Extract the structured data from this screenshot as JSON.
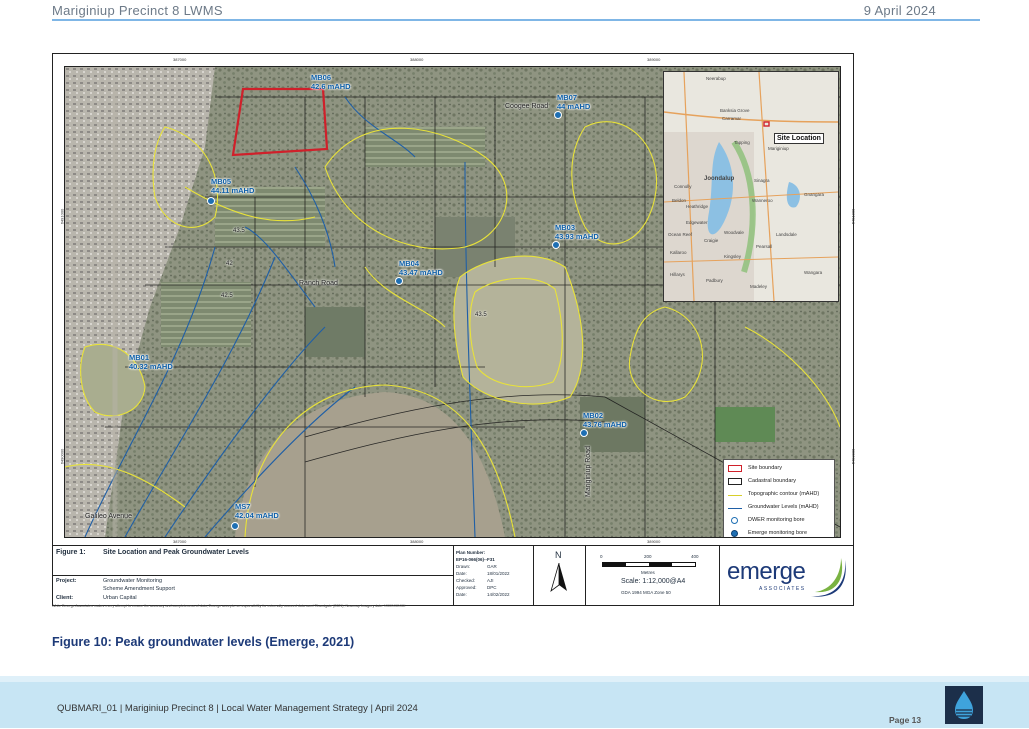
{
  "header": {
    "left": "Mariginiup Precinct 8 LWMS",
    "right": "9 April 2024"
  },
  "map": {
    "coords_top": [
      "387000",
      "388000",
      "389000"
    ],
    "coords_bottom": [
      "387000",
      "388000",
      "389000"
    ],
    "coords_side": [
      "6491000",
      "6490000"
    ],
    "bores": [
      {
        "id": "MB06",
        "level": "42.6 mAHD"
      },
      {
        "id": "MB07",
        "level": "44 mAHD"
      },
      {
        "id": "MB05",
        "level": "44.11 mAHD"
      },
      {
        "id": "MB03",
        "level": "43.93 mAHD"
      },
      {
        "id": "MB04",
        "level": "43.47 mAHD"
      },
      {
        "id": "MB01",
        "level": "40.32 mAHD"
      },
      {
        "id": "MB02",
        "level": "43.76 mAHD"
      },
      {
        "id": "MS7",
        "level": "42.04 mAHD"
      }
    ],
    "roads": [
      "Ranch Road",
      "Coogee Road",
      "Galileo Avenue",
      "Mariginiup Road"
    ],
    "contour_labels": [
      "43.5",
      "42",
      "42.5",
      "43.5"
    ],
    "inset": {
      "site_label": "Site Location",
      "places": [
        "Neerabup",
        "Banksia Grove",
        "Carramar",
        "Tapping",
        "Mariginiup",
        "Joondalup",
        "Connolly",
        "Sinagra",
        "Wanneroo",
        "Heathridge",
        "Edgewater",
        "Woodvale",
        "Craigie",
        "Kingsley",
        "Landsdale",
        "Pearsall",
        "Kallaroo",
        "Hillarys",
        "Padbury",
        "Madeley",
        "Gnangara",
        "Wangara",
        "Ocean Reef",
        "Beldon"
      ]
    },
    "legend": [
      {
        "label": "Site boundary",
        "sym": "site"
      },
      {
        "label": "Cadastral boundary",
        "sym": "cad"
      },
      {
        "label": "Topographic contour (mAHD)",
        "sym": "topo"
      },
      {
        "label": "Groundwater Levels (mAHD)",
        "sym": "gw"
      },
      {
        "label": "DWER monitoring bore",
        "sym": "dwer"
      },
      {
        "label": "Emerge monitoring bore",
        "sym": "emerge"
      }
    ]
  },
  "titleblock": {
    "figure_key": "Figure 1:",
    "figure_title": "Site Location and Peak Groundwater Levels",
    "project_key": "Project:",
    "project_val1": "Groundwater Monitoring",
    "project_val2": "Scheme Amendment Support",
    "client_key": "Client:",
    "client_val": "Urban Capital",
    "plan_number_label": "Plan Number:",
    "plan_number": "EP16-066(06)--F31",
    "drawn_key": "Drawn:",
    "drawn_val": "GAR",
    "date_key": "Date:",
    "date_val": "18/01/2022",
    "checked_key": "Checked:",
    "checked_val": "AJI",
    "approved_key": "Approved:",
    "approved_val": "DPC",
    "date2_key": "Date:",
    "date2_val": "14/02/2022",
    "north": "N",
    "scale_ticks": [
      "0",
      "200",
      "400"
    ],
    "scale_units": "Metres",
    "scale": "Scale: 1:12,000@A4",
    "datum": "GDA 1994 MGA Zone 50",
    "logo_main": "emerge",
    "logo_sub": "ASSOCIATES"
  },
  "disclaimer": "While Emerge Associates makes every attempt to ensure the accuracy and completeness of data, Emerge accepts no responsibility for externally sourced data used ©Landgate (2021), Nearmap Imagery date: XX/XX/XXXX",
  "caption": "Figure 10: Peak groundwater levels (Emerge, 2021)",
  "footer": {
    "text": "QUBMARI_01 | Mariginiup Precinct 8 | Local Water Management Strategy | April 2024",
    "page": "Page 13"
  },
  "colors": {
    "accent": "#1d3a78",
    "contour": "#e8e23a",
    "groundwater": "#1f5fa6",
    "site": "#d0202a",
    "band": "#c7e5f4"
  }
}
